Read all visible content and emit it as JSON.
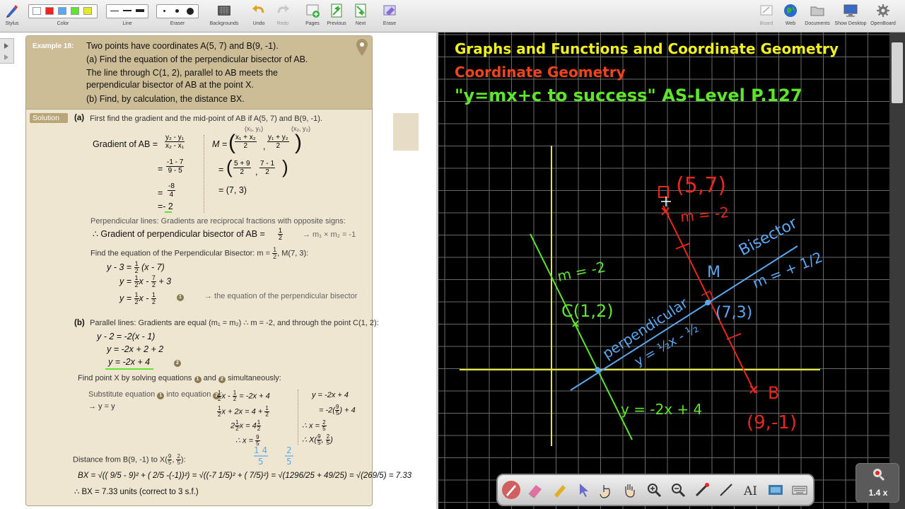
{
  "toolbar": {
    "groups": [
      {
        "id": "stylus",
        "label": "Stylus"
      },
      {
        "id": "color",
        "label": "Color"
      },
      {
        "id": "line",
        "label": "Line"
      },
      {
        "id": "eraser",
        "label": "Eraser"
      },
      {
        "id": "backgrounds",
        "label": "Backgrounds"
      },
      {
        "id": "undo",
        "label": "Undo"
      },
      {
        "id": "redo",
        "label": "Redo"
      },
      {
        "id": "pages",
        "label": "Pages"
      },
      {
        "id": "previous",
        "label": "Previous"
      },
      {
        "id": "next",
        "label": "Next"
      },
      {
        "id": "erase",
        "label": "Erase"
      },
      {
        "id": "board",
        "label": "Board"
      },
      {
        "id": "web",
        "label": "Web"
      },
      {
        "id": "documents",
        "label": "Documents"
      },
      {
        "id": "show_desktop",
        "label": "Show Desktop"
      },
      {
        "id": "openboard",
        "label": "OpenBoard"
      }
    ],
    "colors": [
      "#ffffff",
      "#e8281e",
      "#5aa8f0",
      "#e8e82a"
    ]
  },
  "doc": {
    "example_label": "Example 18:",
    "q_line1": "Two points have coordinates A(5, 7) and B(9, -1).",
    "q_line2": "(a)  Find the equation of the perpendicular bisector of AB.",
    "q_line3": "The line through C(1, 2), parallel to AB meets the",
    "q_line4": "perpendicular bisector of AB at the point X.",
    "q_line5": "(b)  Find, by calculation, the distance BX.",
    "solution_label": "Solution",
    "a_label": "(a)",
    "a_intro": "First find the gradient and the mid-point of AB if A(5, 7) and B(9, -1).",
    "sub_x1y1": "(x₁, y₁)",
    "sub_x2y2": "(x₂, y₂)",
    "grad_label": "Gradient of AB =",
    "grad_f1_n": "y₂ - y₁",
    "grad_f1_d": "x₂ - x₁",
    "grad_f2_n": "-1 - 7",
    "grad_f2_d": "9 - 5",
    "grad_f3_n": "-8",
    "grad_f3_d": "4",
    "grad_result": "=- 2",
    "mid_label": "M =",
    "mid_f1_n": "x₁ + x₂",
    "mid_f1_d": "2",
    "mid_f2_n": "y₁ + y₂",
    "mid_f2_d": "2",
    "mid_f3_n": "5 + 9",
    "mid_f3_d": "2",
    "mid_f4_n": "7 - 1",
    "mid_f4_d": "2",
    "mid_result": "= (7, 3)",
    "perp_lines": "Perpendicular lines: Gradients are reciprocal fractions with opposite signs:",
    "perp_grad": "∴  Gradient of perpendicular bisector of AB =",
    "perp_grad_val_n": "1",
    "perp_grad_val_d": "2",
    "perp_rule": "→ m₁ × m₂ = -1",
    "find_eq": "Find the equation of the Perpendicular Bisector: m =",
    "find_eq_tail": ", M(7, 3):",
    "eq1": "y - 3 =",
    "eq1_tail": "(x - 7)",
    "eq2": "y =",
    "eq2_mid": "x -",
    "eq2_tail": "+ 3",
    "eq3": "y =",
    "eq3_mid": "x -",
    "eq3_num": "1",
    "eq3_note": "→ the equation of the perpendicular bisector",
    "b_label": "(b)",
    "b_intro": "Parallel lines: Gradients are equal (m₁ = m₂) ∴ m = -2, and through the point C(1, 2):",
    "b_eq1": "y - 2 = -2(x - 1)",
    "b_eq2": "y = -2x + 2 + 2",
    "b_eq3": "y = -2x + 4",
    "b_eq3_num": "2",
    "find_x": "Find point X by solving equations",
    "find_x_mid": "and",
    "find_x_tail": "simultaneously:",
    "subst": "Substitute equation",
    "subst_mid": "into equation",
    "subst_arrow": "→ y = y",
    "sim1": "x -",
    "sim1_tail": "= -2x + 4",
    "sim2": "x + 2x = 4 +",
    "sim3": "x = 4",
    "sim4": "∴  x =",
    "sim_right1": "y = -2x + 4",
    "sim_right2": "= -2(",
    "sim_right2_tail": ") + 4",
    "sim_right3": "∴  x =",
    "sim_right4": "∴  X(",
    "hand_1": "1 4",
    "hand_2": "2",
    "dist_label": "Distance from B(9, -1) to X(",
    "dist_tail": "):",
    "bx_formula": "BX = √(( 9/5 - 9)² + ( 2/5 -(-1))²) = √((-7 1/5)² + ( 7/5)²) = √(1296/25 + 49/25) = √(269/5) = 7.33",
    "bx_result": "∴  BX = 7.33 units (correct to 3 s.f.)"
  },
  "board": {
    "title1": "Graphs and Functions and Coordinate Geometry",
    "title2": "Coordinate Geometry",
    "title3": "\"y=mx+c to success\"  AS-Level P.127",
    "title1_color": "#f0f01e",
    "title2_color": "#f0441e",
    "title3_color": "#5ee62a",
    "hand_labels": {
      "a_point": "(5,7)",
      "m_red": "m = -2",
      "bisector": "Bisector",
      "m_half": "m = + 1/2",
      "M": "M",
      "m_mid": "(7,3)",
      "m_green": "m = -2",
      "c_point": "C(1,2)",
      "perpendicular": "perpendicular",
      "y_eq": "y = ½x - ½",
      "b_point": "B",
      "b_coord": "(9,-1)",
      "y_line": "y = -2x + 4"
    }
  },
  "dock": {
    "tools": [
      "pen-tool",
      "eraser-tool",
      "highlighter-tool",
      "pointer-tool",
      "play-tool",
      "hand-tool",
      "zoom-in-tool",
      "zoom-out-tool",
      "laser-tool",
      "line-tool",
      "text-tool",
      "capture-tool",
      "keyboard-tool"
    ]
  },
  "zoom": {
    "label": "1.4 x"
  }
}
